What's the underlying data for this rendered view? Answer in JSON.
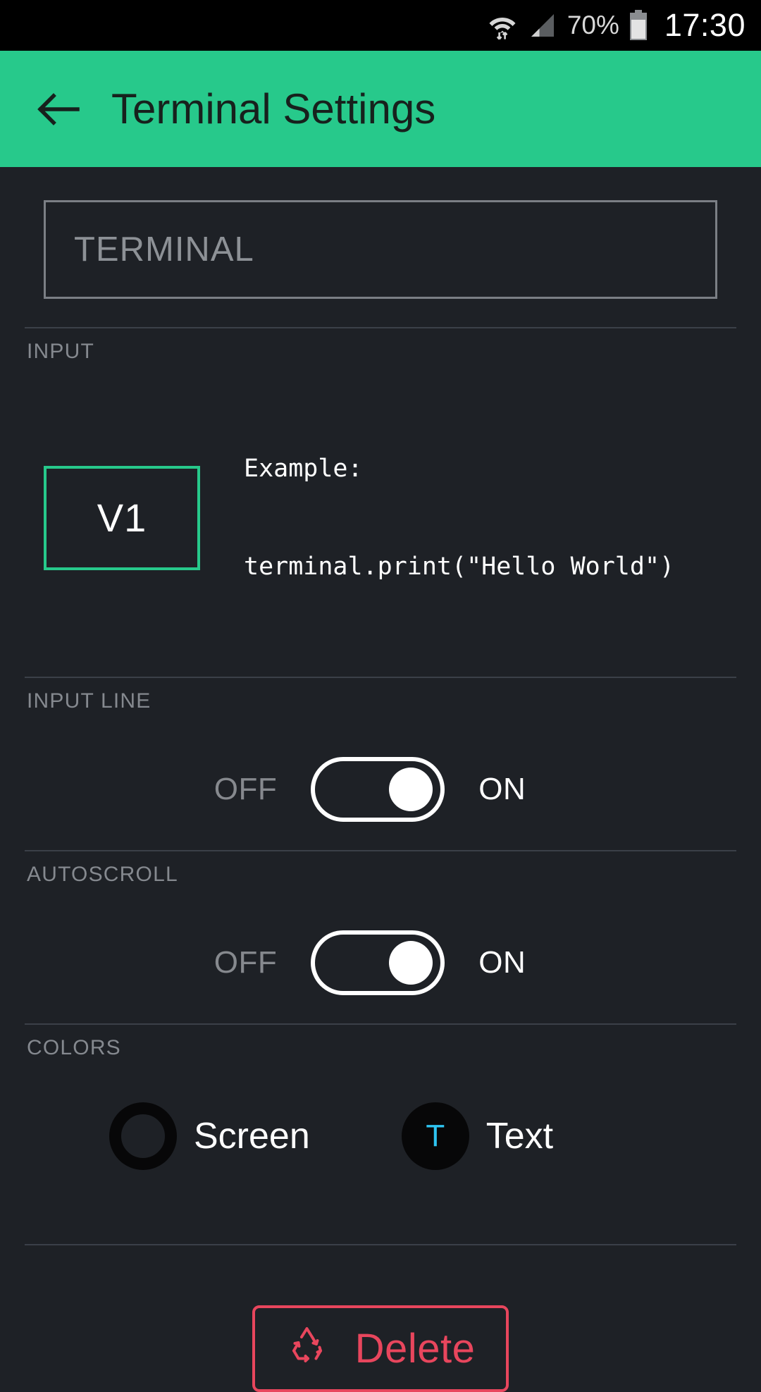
{
  "status_bar": {
    "wifi_icon": "wifi-with-transfer-icon",
    "signal_icon": "cellular-signal-icon",
    "battery_percent": "70%",
    "battery_icon": "battery-icon",
    "time": "17:30"
  },
  "header": {
    "back_icon": "back-arrow-icon",
    "title": "Terminal Settings",
    "background_color": "#27c98b",
    "title_color": "#17211d"
  },
  "name_field": {
    "value": "TERMINAL",
    "placeholder": "TERMINAL"
  },
  "sections": {
    "input": {
      "label": "INPUT",
      "version_button": "V1",
      "example_line1": "Example:",
      "example_line2": "terminal.print(\"Hello World\")"
    },
    "input_line": {
      "label": "INPUT LINE",
      "off_label": "OFF",
      "on_label": "ON",
      "state": "ON"
    },
    "autoscroll": {
      "label": "AUTOSCROLL",
      "off_label": "OFF",
      "on_label": "ON",
      "state": "ON"
    },
    "colors": {
      "label": "COLORS",
      "screen_label": "Screen",
      "screen_swatch_color": "#070708",
      "text_label": "Text",
      "text_swatch_color": "#070708",
      "text_letter": "T",
      "text_letter_color": "#2ec4f1"
    }
  },
  "delete_button": {
    "label": "Delete",
    "icon": "recycle-icon",
    "accent_color": "#e8465d"
  }
}
